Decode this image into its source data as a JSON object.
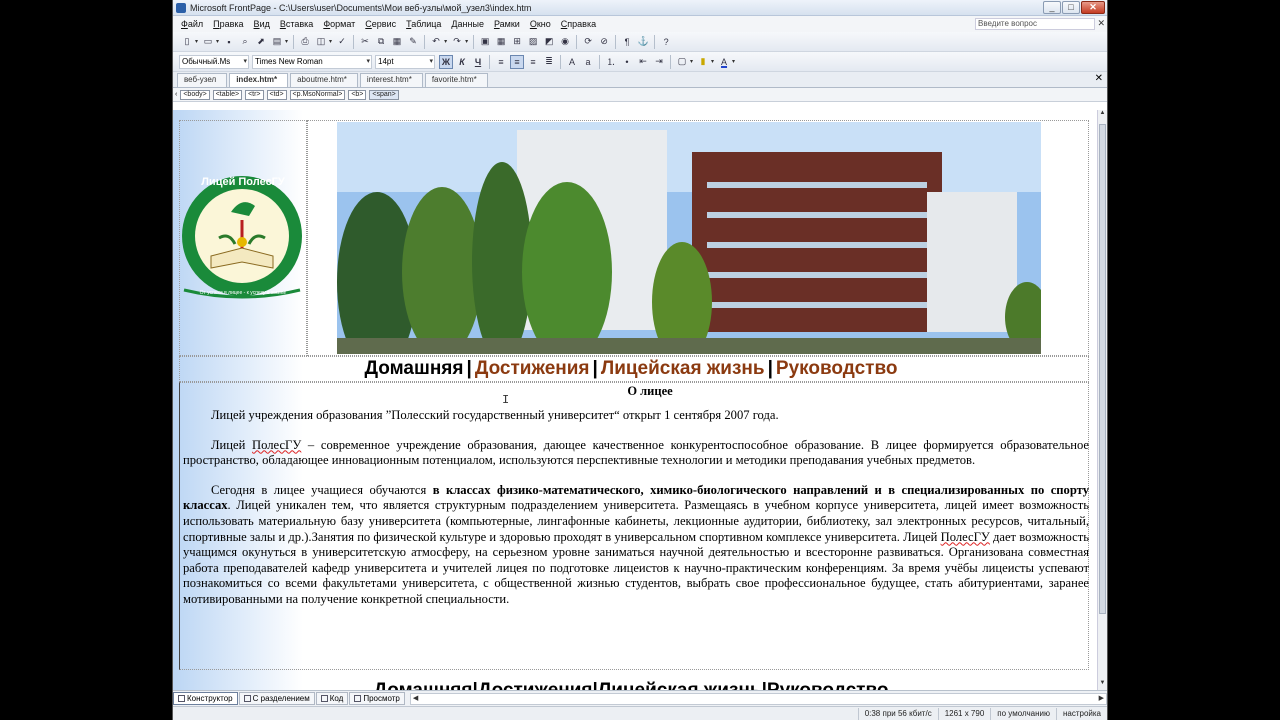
{
  "window": {
    "title": "Microsoft FrontPage - C:\\Users\\user\\Documents\\Мои веб-узлы\\мой_узел3\\index.htm"
  },
  "menu": {
    "items": [
      "Файл",
      "Правка",
      "Вид",
      "Вставка",
      "Формат",
      "Сервис",
      "Таблица",
      "Данные",
      "Рамки",
      "Окно",
      "Справка"
    ],
    "question_placeholder": "Введите вопрос"
  },
  "format_toolbar": {
    "style": "Обычный.Ms",
    "font": "Times New Roman",
    "size": "14pt",
    "bold": "Ж",
    "italic": "К",
    "underline": "Ч"
  },
  "tabs": [
    {
      "label": "веб-узел"
    },
    {
      "label": "index.htm*"
    },
    {
      "label": "aboutme.htm*"
    },
    {
      "label": "interest.htm*"
    },
    {
      "label": "favorite.htm*"
    }
  ],
  "tag_path": [
    "<body>",
    "<table>",
    "<tr>",
    "<td>",
    "<p.MsoNormal>",
    "<b>",
    "<span>"
  ],
  "page": {
    "logo_text_top": "Лицей ПолесГУ",
    "logo_text_ring": "От успеха в лицее - к успеху в жизни!",
    "nav": {
      "home": "Домашняя",
      "achievements": "Достижения",
      "life": "Лицейская жизнь",
      "management": "Руководство",
      "sep": "|"
    },
    "heading": "О лицее",
    "p1": "Лицей учреждения образования ”Полесский государственный университет“ открыт 1 сентября 2007 года.",
    "p2_a": "Лицей ",
    "p2_link": "ПолесГУ",
    "p2_b": " – современное учреждение образования, дающее качественное конкурентоспособное образование. В лицее формируется образовательное пространство, обладающее инновационным потенциалом, используются перспективные технологии и методики преподавания учебных предметов.",
    "p3_a": "Сегодня в лицее учащиеся обучаются ",
    "p3_bold": "в классах физико-математического, химико-биологического направлений и в специализированных по спорту классах",
    "p3_b": ". Лицей уникален тем, что является структурным подразделением университета. Размещаясь в учебном корпусе университета, лицей имеет возможность использовать материальную базу университета (компьютерные, лингафонные кабинеты, лекционные аудитории, библиотеку, зал электронных ресурсов, читальный, спортивные залы и др.).Занятия по физической культуре и здоровью проходят в универсальном спортивном комплексе университета. Лицей ",
    "p3_link": "ПолесГУ",
    "p3_c": " дает возможность учащимся окунуться в университетскую атмосферу, на серьезном уровне заниматься научной деятельностью и всесторонне развиваться. Организована совместная работа преподавателей кафедр университета и учителей лицея по подготовке лицеистов к научно-практическим  конференциям. За время учёбы лицеисты успевают познакомиться со всеми факультетами университета, с общественной жизнью студентов, выбрать свое профессиональное будущее, стать абитуриентами, заранее мотивированными на получение конкретной специальности."
  },
  "view_tabs": [
    "Конструктор",
    "С разделением",
    "Код",
    "Просмотр"
  ],
  "status": {
    "download": "0:38 при 56 кбит/с",
    "size": "1261 x 790",
    "style": "по умолчанию",
    "custom": "настройка"
  }
}
